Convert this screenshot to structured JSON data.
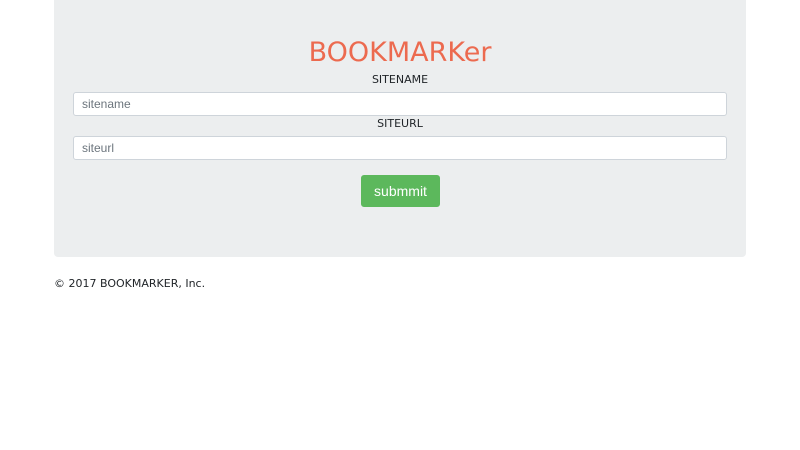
{
  "header": {
    "brand": "BOOKMARKer"
  },
  "form": {
    "sitename_label": "SITENAME",
    "sitename_placeholder": "sitename",
    "sitename_value": "",
    "siteurl_label": "SITEURL",
    "siteurl_placeholder": "siteurl",
    "siteurl_value": "",
    "submit_label": "submmit"
  },
  "footer": {
    "text": "© 2017 BOOKMARKER, Inc."
  },
  "colors": {
    "brand": "#ec6a4f",
    "panel_background": "#eceeef",
    "submit_button": "#5cb85c"
  }
}
